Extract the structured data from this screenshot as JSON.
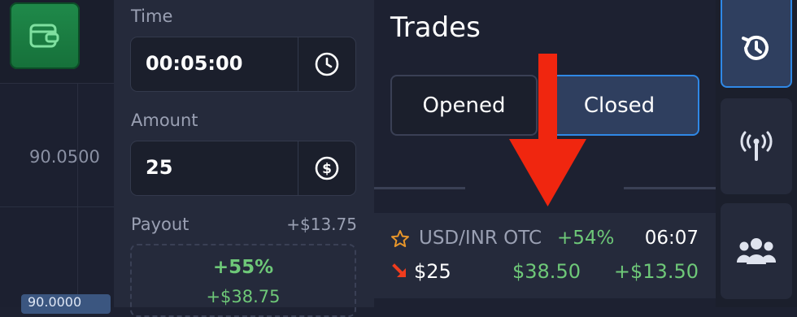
{
  "chart": {
    "price_label": "90.0500",
    "price_badge": "90.0000"
  },
  "trade_panel": {
    "time_label": "Time",
    "time_value": "00:05:00",
    "amount_label": "Amount",
    "amount_value": "25",
    "payout_label": "Payout",
    "payout_value": "+$13.75",
    "payout_percent": "+55%",
    "payout_amount": "+$38.75"
  },
  "trades": {
    "title": "Trades",
    "tabs": [
      {
        "label": "Opened",
        "active": false
      },
      {
        "label": "Closed",
        "active": true
      }
    ],
    "items": [
      {
        "pair": "USD/INR OTC",
        "percent": "+54%",
        "time": "06:07",
        "direction": "down",
        "amount": "$25",
        "return": "$38.50",
        "profit": "+$13.50"
      }
    ]
  },
  "sidebar": {
    "items": [
      {
        "icon": "history-icon",
        "active": true
      },
      {
        "icon": "signal-icon",
        "active": false
      },
      {
        "icon": "social-trading-icon",
        "active": false
      }
    ]
  },
  "colors": {
    "background": "#1d2131",
    "panel": "#252a3b",
    "accent": "#2f88e6",
    "positive": "#6ec878",
    "wallet": "#1f8a4a",
    "annotation_arrow": "#f0260f",
    "down_arrow": "#ef3c1e",
    "star": "#e8962a"
  }
}
